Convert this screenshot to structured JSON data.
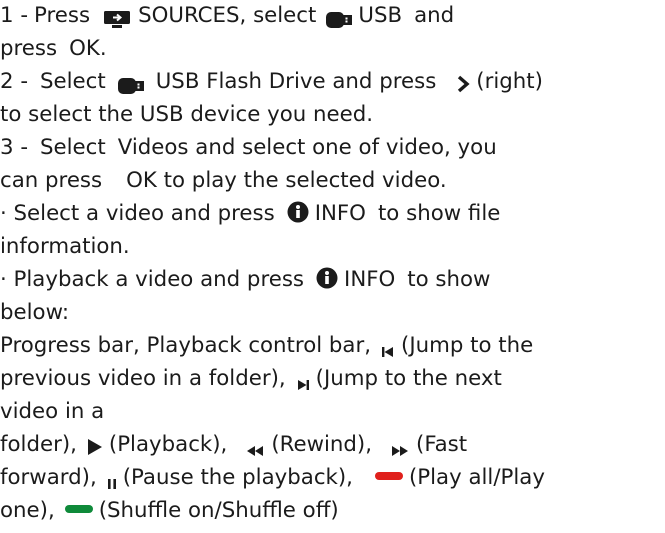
{
  "steps": {
    "s1": {
      "num": "1 -",
      "press": "Press",
      "sources": "SOURCES",
      "select": ", select",
      "usb": "USB",
      "and": "and",
      "press2": "press",
      "ok": "OK",
      "period": "."
    },
    "s2": {
      "num": "2 -",
      "select": "Select",
      "flash": "USB Flash Drive",
      "and_press": "and press",
      "right": "(right)",
      "line2": "to select the USB device you need."
    },
    "s3": {
      "num": "3 -",
      "select": "Select",
      "videos": "Videos",
      "rest": "and select one of video, you",
      "can_press": "can press",
      "ok": "OK",
      "rest2": "to play the selected video."
    }
  },
  "bullet1": {
    "text": "· Select a video and press",
    "info": "INFO",
    "tail": "to show file",
    "line2": "information."
  },
  "bullet2": {
    "text": "· Playback a video and press",
    "info": "INFO",
    "tail": "to show",
    "line2": "below:"
  },
  "controls": {
    "l1a": "Progress bar, Playback control bar,",
    "l1b": "(Jump to the",
    "l2a": "previous video in a folder),",
    "l2b": "(Jump to the next",
    "l3": "video in a",
    "l4a": "folder),",
    "l4b": "(Playback),",
    "l4c": "(Rewind),",
    "l4d": "(Fast",
    "l5a": "forward),",
    "l5b": "(Pause the playback),",
    "l5c": "(Play all/Play",
    "l6a": "one),",
    "l6b": "(Shuffle on/Shuffle off)"
  },
  "icons": {
    "sources": "sources-icon",
    "usb": "usb-icon",
    "right": "chevron-right-icon",
    "info": "info-icon",
    "prev": "skip-previous-icon",
    "next": "skip-next-icon",
    "play": "play-icon",
    "rewind": "rewind-icon",
    "ffwd": "fast-forward-icon",
    "pause": "pause-icon",
    "red_key": "red-color-key",
    "green_key": "green-color-key"
  },
  "colors": {
    "text": "#1b1b1b",
    "red_key": "#e0201c",
    "green_key": "#0f8a3a"
  }
}
